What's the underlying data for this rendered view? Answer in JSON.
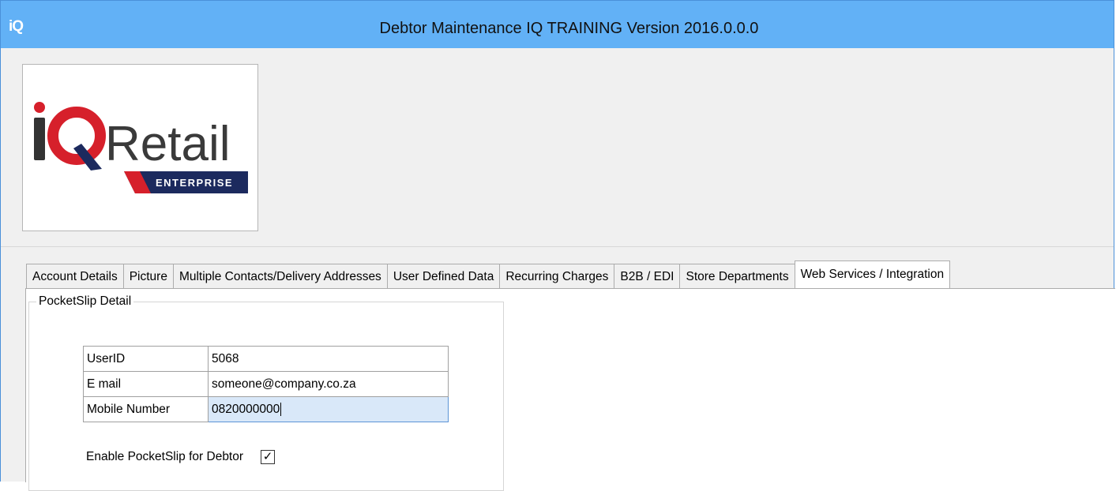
{
  "window": {
    "app_icon_text": "iQ",
    "title": "Debtor Maintenance IQ TRAINING Version 2016.0.0.0"
  },
  "logo": {
    "brand_letters": "iQ",
    "brand_word": "Retail",
    "ribbon_text": "ENTERPRISE",
    "colors": {
      "red": "#d6202b",
      "navy": "#1c2a5e",
      "dark": "#333333"
    }
  },
  "tabs": [
    {
      "label": "Account Details",
      "active": false
    },
    {
      "label": "Picture",
      "active": false
    },
    {
      "label": "Multiple Contacts/Delivery Addresses",
      "active": false
    },
    {
      "label": "User Defined Data",
      "active": false
    },
    {
      "label": "Recurring Charges",
      "active": false
    },
    {
      "label": "B2B / EDI",
      "active": false
    },
    {
      "label": "Store Departments",
      "active": false
    },
    {
      "label": "Web Services / Integration",
      "active": true
    }
  ],
  "pocketslip": {
    "group_title": "PocketSlip Detail",
    "rows": [
      {
        "label": "UserID",
        "value": "5068"
      },
      {
        "label": "E mail",
        "value": "someone@company.co.za"
      },
      {
        "label": "Mobile Number",
        "value": "0820000000"
      }
    ],
    "enable_label": "Enable PocketSlip for Debtor",
    "enable_checked": true,
    "check_glyph": "✓"
  }
}
